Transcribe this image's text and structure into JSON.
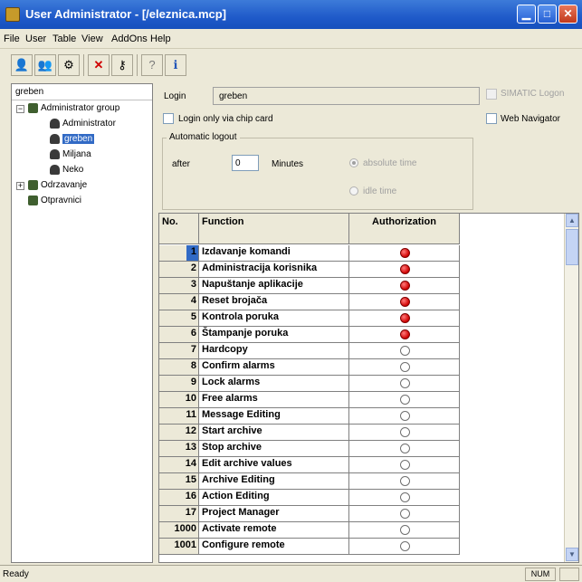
{
  "window": {
    "title": "User Administrator - [/eleznica.mcp]",
    "minimize": "▁",
    "maximize": "□",
    "close": "✕"
  },
  "menu": [
    "File",
    "User",
    "Table",
    "View",
    "AddOns",
    "Help"
  ],
  "toolbar": {
    "icons": [
      "new-user-icon",
      "copy-user-icon",
      "user-properties-icon",
      "delete-icon",
      "key-icon",
      "help-icon",
      "info-icon"
    ]
  },
  "sidebar": {
    "current_user": "greben",
    "tree": [
      {
        "label": "Administrator group",
        "type": "group",
        "expanded": true
      },
      {
        "label": "Administrator",
        "type": "user"
      },
      {
        "label": "greben",
        "type": "user",
        "selected": true
      },
      {
        "label": "Miljana",
        "type": "user"
      },
      {
        "label": "Neko",
        "type": "user"
      },
      {
        "label": "Odrzavanje",
        "type": "group",
        "expanded": false
      },
      {
        "label": "Otpravnici",
        "type": "group"
      }
    ]
  },
  "form": {
    "login_label": "Login",
    "login_value": "greben",
    "simatic_logon_label": "SIMATIC Logon",
    "chip_card_label": "Login only via chip card",
    "web_navigator_label": "Web Navigator",
    "auto_logout_title": "Automatic logout",
    "after_label": "after",
    "minutes_value": "0",
    "minutes_label": "Minutes",
    "absolute_time_label": "absolute time",
    "idle_time_label": "idle time"
  },
  "table": {
    "headers": {
      "no": "No.",
      "function": "Function",
      "authorization": "Authorization"
    },
    "rows": [
      {
        "no": "1",
        "function": "Izdavanje komandi",
        "authorized": true
      },
      {
        "no": "2",
        "function": "Administracija korisnika",
        "authorized": true
      },
      {
        "no": "3",
        "function": "Napuštanje aplikacije",
        "authorized": true
      },
      {
        "no": "4",
        "function": "Reset brojača",
        "authorized": true
      },
      {
        "no": "5",
        "function": "Kontrola poruka",
        "authorized": true
      },
      {
        "no": "6",
        "function": "Štampanje poruka",
        "authorized": true
      },
      {
        "no": "7",
        "function": "Hardcopy",
        "authorized": false
      },
      {
        "no": "8",
        "function": "Confirm alarms",
        "authorized": false
      },
      {
        "no": "9",
        "function": "Lock alarms",
        "authorized": false
      },
      {
        "no": "10",
        "function": "Free alarms",
        "authorized": false
      },
      {
        "no": "11",
        "function": "Message Editing",
        "authorized": false
      },
      {
        "no": "12",
        "function": "Start archive",
        "authorized": false
      },
      {
        "no": "13",
        "function": "Stop archive",
        "authorized": false
      },
      {
        "no": "14",
        "function": "Edit archive values",
        "authorized": false
      },
      {
        "no": "15",
        "function": "Archive Editing",
        "authorized": false
      },
      {
        "no": "16",
        "function": "Action Editing",
        "authorized": false
      },
      {
        "no": "17",
        "function": "Project Manager",
        "authorized": false
      },
      {
        "no": "1000",
        "function": "Activate remote",
        "authorized": false
      },
      {
        "no": "1001",
        "function": "Configure remote",
        "authorized": false
      }
    ]
  },
  "status": {
    "text": "Ready",
    "num": "NUM"
  },
  "colors": {
    "accent": "#1f5ac9",
    "authorized": "#d00000",
    "selection": "#316ac5"
  }
}
